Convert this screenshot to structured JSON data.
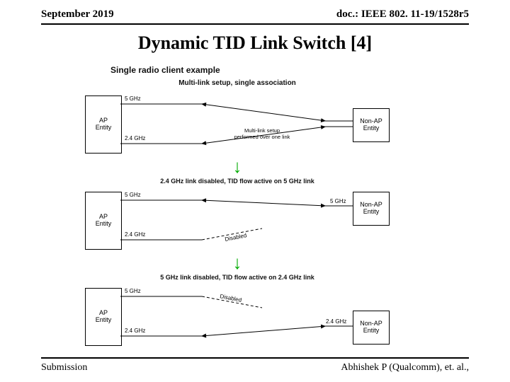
{
  "header": {
    "left": "September 2019",
    "right": "doc.: IEEE 802. 11-19/1528r5"
  },
  "title": "Dynamic TID Link Switch [4]",
  "footer": {
    "left": "Submission",
    "right": "Abhishek P (Qualcomm), et. al.,"
  },
  "figure": {
    "title": "Single radio client example",
    "cap_top": "Multi-link setup, single association",
    "cap_mid": "2.4 GHz link disabled, TID flow active on 5 GHz link",
    "cap_bot": "5 GHz link disabled, TID flow active on 2.4 GHz link",
    "ap": "AP\nEntity",
    "sta": "Non-AP\nEntity",
    "l5": "5 GHz",
    "l24": "2.4 GHz",
    "note": "Multi-link setup performed over one link",
    "disabled": "Disabled"
  }
}
